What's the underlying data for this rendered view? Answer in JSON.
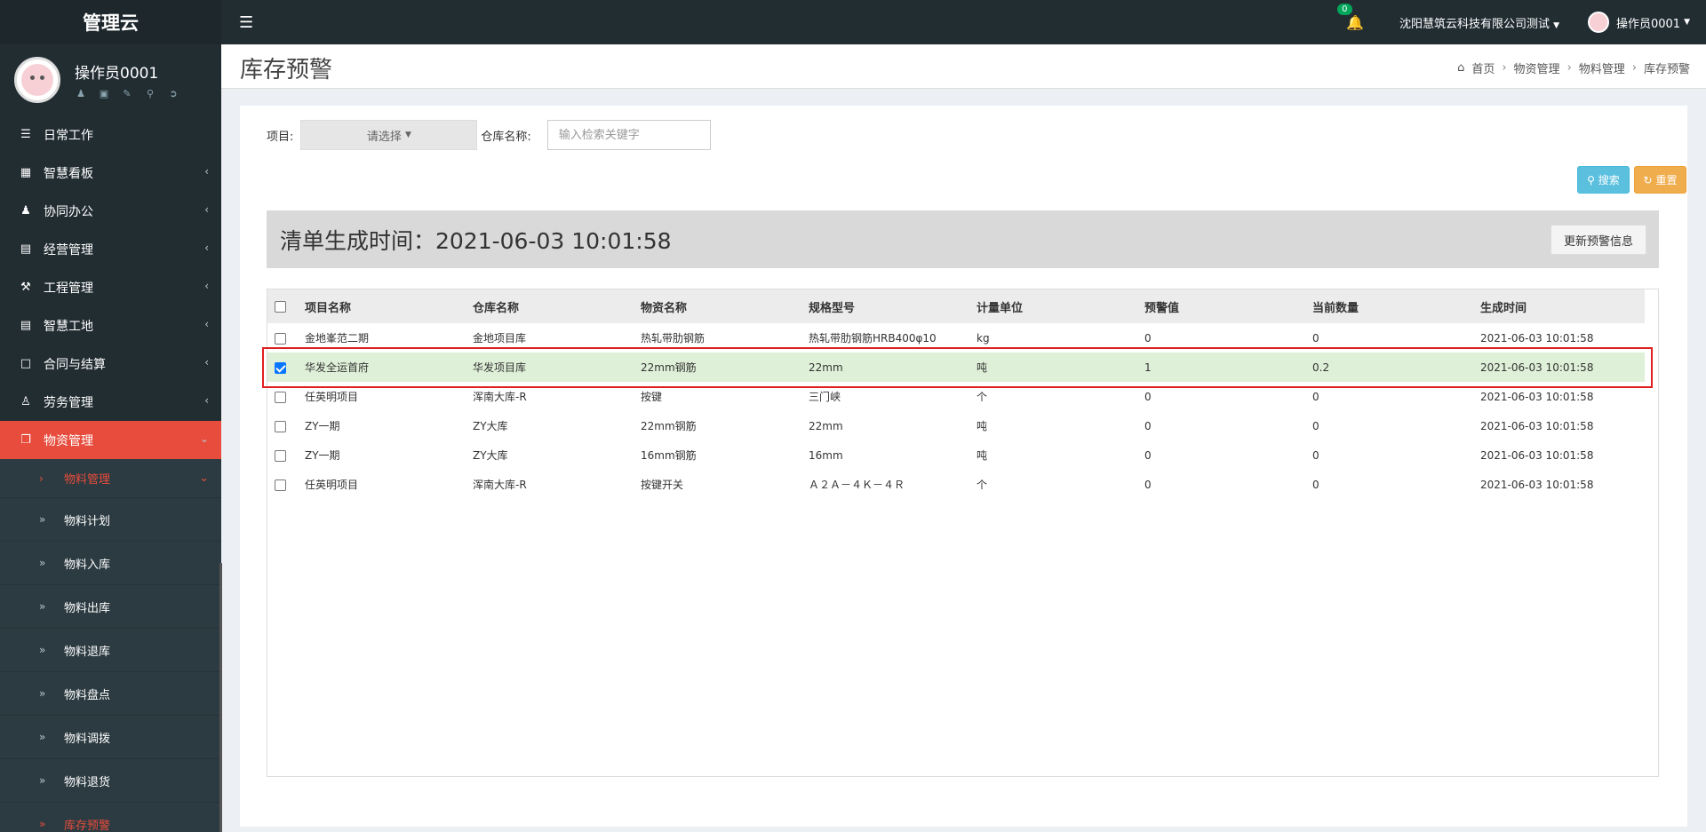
{
  "app": {
    "logo": "管理云"
  },
  "user_panel": {
    "name": "操作员0001"
  },
  "sidebar": {
    "items": [
      {
        "label": "日常工作",
        "icon": "list-icon"
      },
      {
        "label": "智慧看板",
        "icon": "dashboard-icon"
      },
      {
        "label": "协同办公",
        "icon": "users-icon"
      },
      {
        "label": "经营管理",
        "icon": "monitor-icon"
      },
      {
        "label": "工程管理",
        "icon": "hammer-icon"
      },
      {
        "label": "智慧工地",
        "icon": "monitor-icon"
      },
      {
        "label": "合同与结算",
        "icon": "file-icon"
      },
      {
        "label": "劳务管理",
        "icon": "worker-icon"
      },
      {
        "label": "物资管理",
        "icon": "cube-icon"
      }
    ],
    "sub_items": [
      {
        "label": "物料管理"
      },
      {
        "label": "物料计划"
      },
      {
        "label": "物料入库"
      },
      {
        "label": "物料出库"
      },
      {
        "label": "物料退库"
      },
      {
        "label": "物料盘点"
      },
      {
        "label": "物料调拨"
      },
      {
        "label": "物料退货"
      },
      {
        "label": "库存预警"
      }
    ]
  },
  "header": {
    "notification_count": "0",
    "company": "沈阳慧筑云科技有限公司测试",
    "user": "操作员0001"
  },
  "page": {
    "title": "库存预警",
    "breadcrumb": [
      "首页",
      "物资管理",
      "物料管理",
      "库存预警"
    ]
  },
  "filters": {
    "project_label": "项目:",
    "project_placeholder": "请选择",
    "warehouse_label": "仓库名称:",
    "warehouse_placeholder": "输入检索关键字"
  },
  "buttons": {
    "search": "搜索",
    "reset": "重置",
    "update": "更新预警信息"
  },
  "gen_time": "清单生成时间：2021-06-03 10:01:58",
  "table": {
    "headers": [
      "项目名称",
      "仓库名称",
      "物资名称",
      "规格型号",
      "计量单位",
      "预警值",
      "当前数量",
      "生成时间"
    ],
    "rows": [
      {
        "checked": false,
        "cells": [
          "金地峯范二期",
          "金地项目库",
          "热轧带肋钢筋",
          "热轧带肋钢筋HRB400φ10",
          "kg",
          "0",
          "0",
          "2021-06-03 10:01:58"
        ]
      },
      {
        "checked": true,
        "cells": [
          "华发全运首府",
          "华发项目库",
          "22mm钢筋",
          "22mm",
          "吨",
          "1",
          "0.2",
          "2021-06-03 10:01:58"
        ]
      },
      {
        "checked": false,
        "cells": [
          "任英明项目",
          "浑南大库-R",
          "按键",
          "三门峡",
          "个",
          "0",
          "0",
          "2021-06-03 10:01:58"
        ]
      },
      {
        "checked": false,
        "cells": [
          "ZY一期",
          "ZY大库",
          "22mm钢筋",
          "22mm",
          "吨",
          "0",
          "0",
          "2021-06-03 10:01:58"
        ]
      },
      {
        "checked": false,
        "cells": [
          "ZY一期",
          "ZY大库",
          "16mm钢筋",
          "16mm",
          "吨",
          "0",
          "0",
          "2021-06-03 10:01:58"
        ]
      },
      {
        "checked": false,
        "cells": [
          "任英明项目",
          "浑南大库-R",
          "按键开关",
          "Ａ２Ａ－４Ｋ－４Ｒ",
          "个",
          "0",
          "0",
          "2021-06-03 10:01:58"
        ]
      }
    ]
  }
}
